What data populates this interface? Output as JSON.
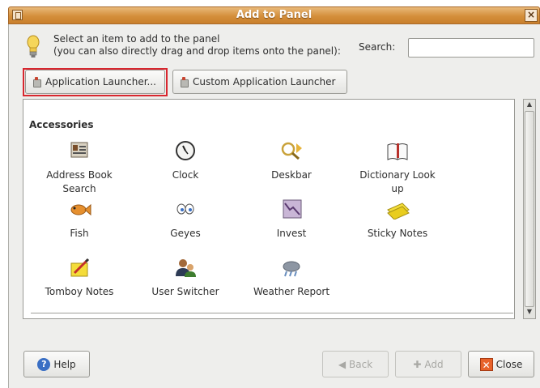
{
  "window": {
    "title": "Add to Panel",
    "close_glyph": "×"
  },
  "instructions": {
    "line1": "Select an item to add to the panel",
    "line2": "(you can also directly drag and drop items onto the panel):"
  },
  "search": {
    "label": "Search:",
    "value": ""
  },
  "launchers": {
    "app_launcher": "Application Launcher...",
    "custom_launcher": "Custom Application Launcher"
  },
  "list": {
    "section": "Accessories",
    "items": [
      {
        "label": "Address Book Search",
        "icon": "address-book-icon"
      },
      {
        "label": "Clock",
        "icon": "clock-icon"
      },
      {
        "label": "Deskbar",
        "icon": "deskbar-icon"
      },
      {
        "label": "Dictionary Look up",
        "icon": "dictionary-icon"
      },
      {
        "label": "Fish",
        "icon": "fish-icon"
      },
      {
        "label": "Geyes",
        "icon": "geyes-icon"
      },
      {
        "label": "Invest",
        "icon": "invest-icon"
      },
      {
        "label": "Sticky Notes",
        "icon": "sticky-notes-icon"
      },
      {
        "label": "Tomboy Notes",
        "icon": "tomboy-notes-icon"
      },
      {
        "label": "User Switcher",
        "icon": "user-switcher-icon"
      },
      {
        "label": "Weather Report",
        "icon": "weather-icon"
      }
    ]
  },
  "buttons": {
    "help": "Help",
    "back": "Back",
    "add": "Add",
    "close": "Close"
  },
  "colors": {
    "titlebar": "#d48f3b",
    "highlight": "#d8262e",
    "close_icon": "#e8622a"
  }
}
